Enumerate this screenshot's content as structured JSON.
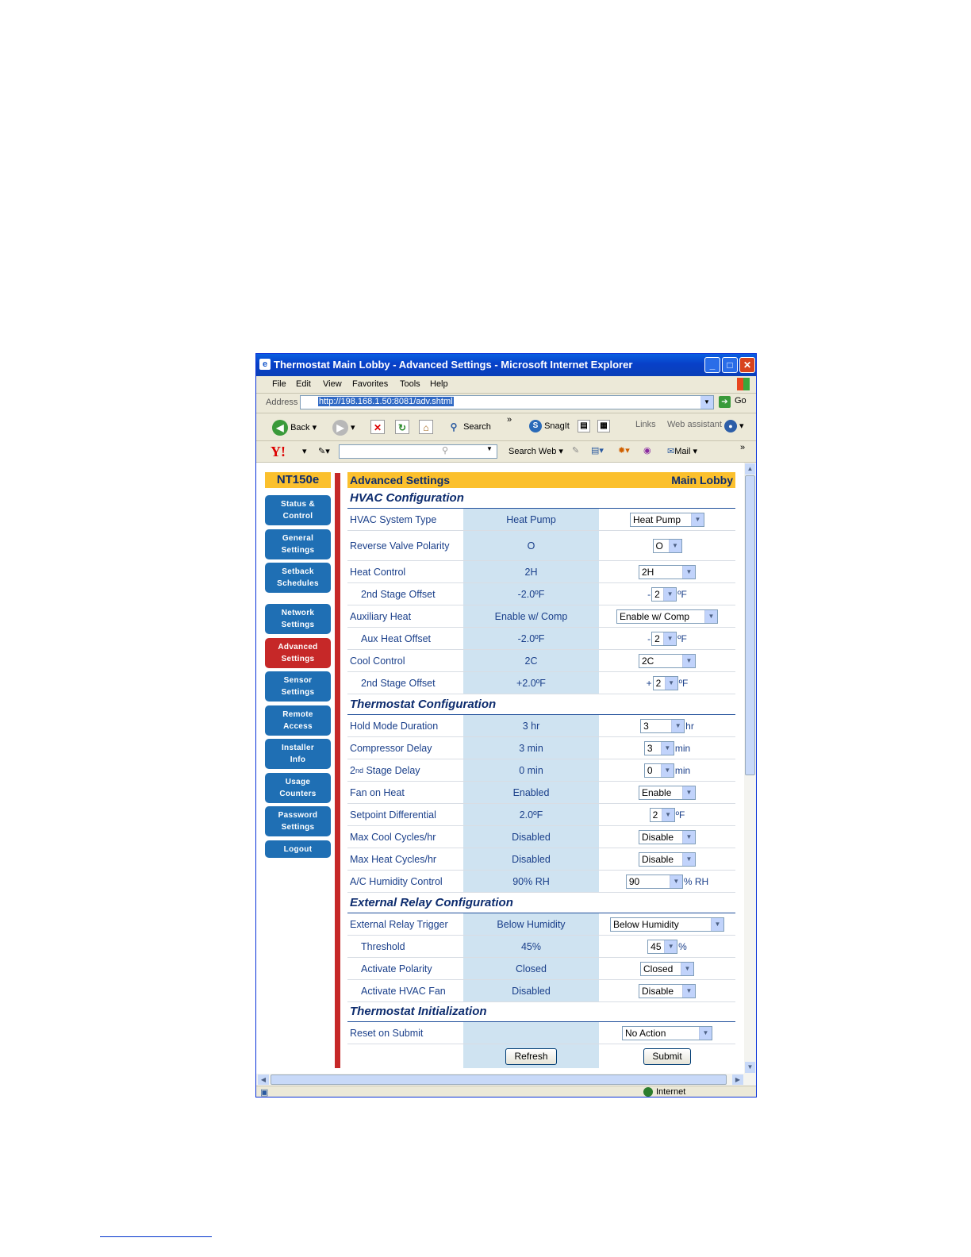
{
  "window": {
    "title": "Thermostat Main Lobby - Advanced Settings - Microsoft Internet Explorer",
    "menu": [
      "File",
      "Edit",
      "View",
      "Favorites",
      "Tools",
      "Help"
    ],
    "address_label": "Address",
    "address_url": "http://198.168.1.50:8081/adv.shtml",
    "go_label": "Go",
    "toolbar": {
      "back": "Back",
      "search": "Search",
      "snagit": "SnagIt",
      "links": "Links",
      "web_assistant": "Web assistant",
      "more": "»"
    },
    "yahoo": {
      "logo": "Y!",
      "search_web": "Search Web",
      "mail": "Mail",
      "more": "»"
    },
    "status": {
      "zone": "Internet"
    }
  },
  "page": {
    "brand": "NT150e",
    "nav": [
      "Status &\nControl",
      "General\nSettings",
      "Setback\nSchedules",
      "Network\nSettings",
      "Advanced\nSettings",
      "Sensor\nSettings",
      "Remote\nAccess",
      "Installer\nInfo",
      "Usage\nCounters",
      "Password\nSettings",
      "Logout"
    ],
    "header_left": "Advanced Settings",
    "header_right": "Main Lobby",
    "sections": {
      "hvac": "HVAC Configuration",
      "thermostat": "Thermostat Configuration",
      "relay": "External Relay Configuration",
      "init": "Thermostat Initialization"
    },
    "rows": {
      "hvac_type": {
        "label": "HVAC System Type",
        "current": "Heat Pump",
        "select": "Heat Pump"
      },
      "reverse_valve": {
        "label": "Reverse Valve Polarity",
        "current": "O",
        "select": "O"
      },
      "heat_control": {
        "label": "Heat Control",
        "current": "2H",
        "select": "2H"
      },
      "heat_stage2": {
        "label": "2nd Stage Offset",
        "current": "-2.0ºF",
        "prefix": "-",
        "select": "2",
        "unit": "ºF"
      },
      "aux_heat": {
        "label": "Auxiliary Heat",
        "current": "Enable w/ Comp",
        "select": "Enable w/ Comp"
      },
      "aux_offset": {
        "label": "Aux Heat Offset",
        "current": "-2.0ºF",
        "prefix": "-",
        "select": "2",
        "unit": "ºF"
      },
      "cool_control": {
        "label": "Cool Control",
        "current": "2C",
        "select": "2C"
      },
      "cool_stage2": {
        "label": "2nd Stage Offset",
        "current": "+2.0ºF",
        "prefix": "+",
        "select": "2",
        "unit": "ºF"
      },
      "hold_mode": {
        "label": "Hold Mode Duration",
        "current": "3 hr",
        "select": "3",
        "unit": "hr"
      },
      "comp_delay": {
        "label": "Compressor Delay",
        "current": "3 min",
        "select": "3",
        "unit": "min"
      },
      "stage_delay": {
        "label_pre": "2",
        "label_sup": "nd",
        "label_post": " Stage Delay",
        "current": "0 min",
        "select": "0",
        "unit": "min"
      },
      "fan_heat": {
        "label": "Fan on Heat",
        "current": "Enabled",
        "select": "Enable"
      },
      "setpoint_diff": {
        "label": "Setpoint Differential",
        "current": "2.0ºF",
        "select": "2",
        "unit": "ºF"
      },
      "max_cool": {
        "label": "Max Cool Cycles/hr",
        "current": "Disabled",
        "select": "Disable"
      },
      "max_heat": {
        "label": "Max Heat Cycles/hr",
        "current": "Disabled",
        "select": "Disable"
      },
      "ac_humidity": {
        "label": "A/C Humidity Control",
        "current": "90% RH",
        "select": "90",
        "unit": "% RH"
      },
      "relay_trigger": {
        "label": "External Relay Trigger",
        "current": "Below Humidity",
        "select": "Below Humidity"
      },
      "threshold": {
        "label": "Threshold",
        "current": "45%",
        "select": "45",
        "unit": "%"
      },
      "act_polarity": {
        "label": "Activate Polarity",
        "current": "Closed",
        "select": "Closed"
      },
      "act_fan": {
        "label": "Activate HVAC Fan",
        "current": "Disabled",
        "select": "Disable"
      },
      "reset": {
        "label": "Reset on Submit",
        "current": "",
        "select": "No Action"
      }
    },
    "buttons": {
      "refresh": "Refresh",
      "submit": "Submit"
    }
  }
}
